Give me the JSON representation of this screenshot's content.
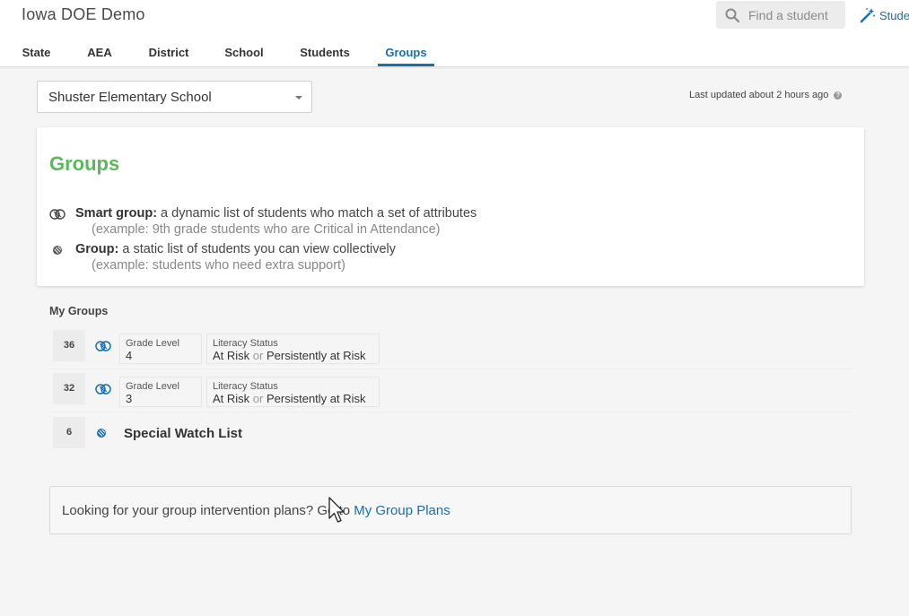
{
  "header": {
    "app_title": "Iowa DOE Demo",
    "search_placeholder": "Find a student",
    "student_link_label": "Stude"
  },
  "nav": {
    "tabs": [
      {
        "label": "State",
        "active": false
      },
      {
        "label": "AEA",
        "active": false
      },
      {
        "label": "District",
        "active": false
      },
      {
        "label": "School",
        "active": false
      },
      {
        "label": "Students",
        "active": false
      },
      {
        "label": "Groups",
        "active": true
      }
    ]
  },
  "toolbar": {
    "school_selected": "Shuster Elementary School",
    "last_updated": "Last updated about 2 hours ago"
  },
  "info": {
    "heading": "Groups",
    "smart_group": {
      "term": "Smart group:",
      "definition": " a dynamic list of students who match a set of attributes",
      "example": "(example: 9th grade students who are Critical in Attendance)"
    },
    "group": {
      "term": "Group:",
      "definition": " a static list of students you can view collectively",
      "example": "(example: students who need extra support)"
    }
  },
  "my_groups": {
    "title": "My Groups",
    "rows": [
      {
        "count": "36",
        "type": "smart",
        "criteria": [
          {
            "key": "Grade Level",
            "value": "4"
          },
          {
            "key": "Literacy Status",
            "value_a": "At Risk",
            "or": "or",
            "value_b": "Persistently at Risk"
          }
        ]
      },
      {
        "count": "32",
        "type": "smart",
        "criteria": [
          {
            "key": "Grade Level",
            "value": "3"
          },
          {
            "key": "Literacy Status",
            "value_a": "At Risk",
            "or": "or",
            "value_b": "Persistently at Risk"
          }
        ]
      },
      {
        "count": "6",
        "type": "static",
        "name": "Special Watch List"
      }
    ]
  },
  "plans_callout": {
    "text": "Looking for your group intervention plans? Go to ",
    "link": "My Group Plans"
  },
  "colors": {
    "accent_blue": "#1b6ea8",
    "heading_green": "#5cb85c"
  },
  "icons": [
    "search-icon",
    "magic-wand-icon",
    "help-icon",
    "smart-group-icon",
    "group-icon",
    "chevron-down-icon",
    "mouse-cursor-icon"
  ]
}
